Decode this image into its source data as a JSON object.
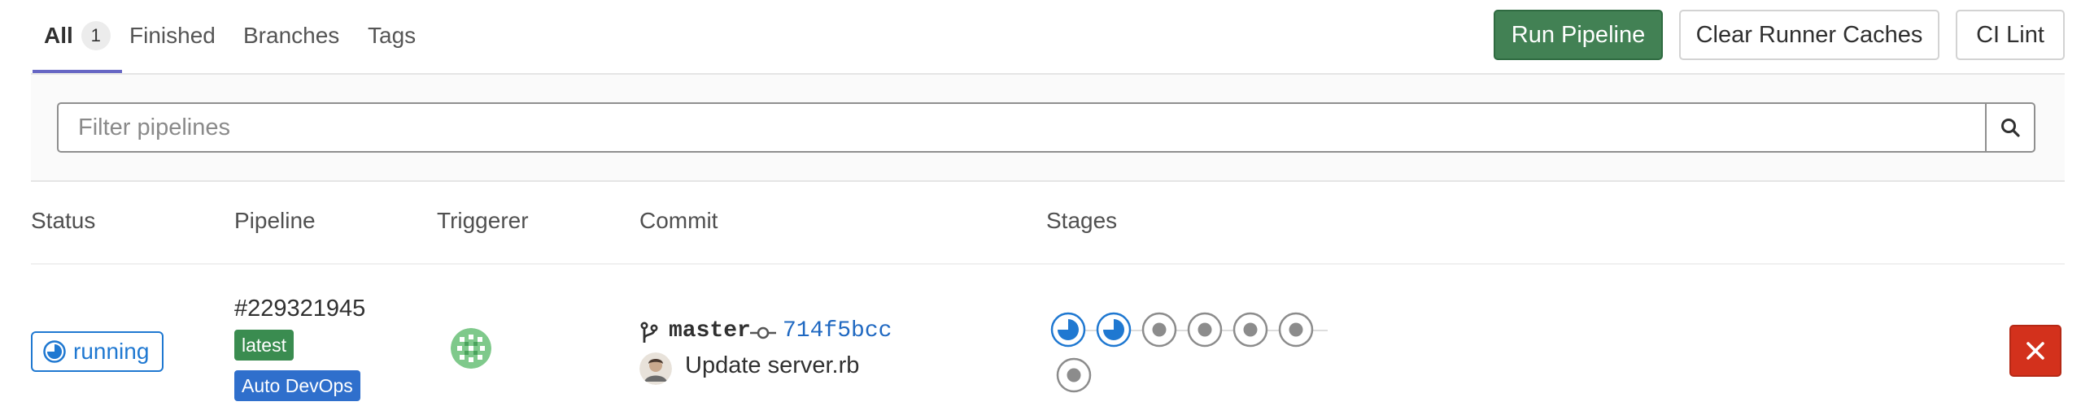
{
  "tabs": [
    {
      "label": "All",
      "count": "1",
      "active": true
    },
    {
      "label": "Finished"
    },
    {
      "label": "Branches"
    },
    {
      "label": "Tags"
    }
  ],
  "actions": {
    "run_pipeline": "Run Pipeline",
    "clear_caches": "Clear Runner Caches",
    "ci_lint": "CI Lint"
  },
  "filter": {
    "placeholder": "Filter pipelines",
    "value": ""
  },
  "table": {
    "headers": [
      "Status",
      "Pipeline",
      "Triggerer",
      "Commit",
      "Stages"
    ]
  },
  "pipeline": {
    "status": "running",
    "id": "#229321945",
    "badges": [
      "latest",
      "Auto DevOps"
    ],
    "commit": {
      "branch": "master",
      "sha": "714f5bcc",
      "title": "Update server.rb"
    },
    "stages": [
      "running",
      "running",
      "pending",
      "pending",
      "pending",
      "pending",
      "pending"
    ]
  },
  "colors": {
    "primary_green": "#428154",
    "running_blue": "#1f78d1",
    "link_blue": "#1f68c1",
    "danger_red": "#d3311c",
    "tab_indicator": "#6666c4",
    "badge_latest": "#3a8c50",
    "badge_devops": "#2f6fcc"
  },
  "icons": {
    "search": "search-icon",
    "status_running": "status-running-icon",
    "branch": "git-branch-icon",
    "commit": "git-commit-icon",
    "cancel": "close-icon"
  }
}
